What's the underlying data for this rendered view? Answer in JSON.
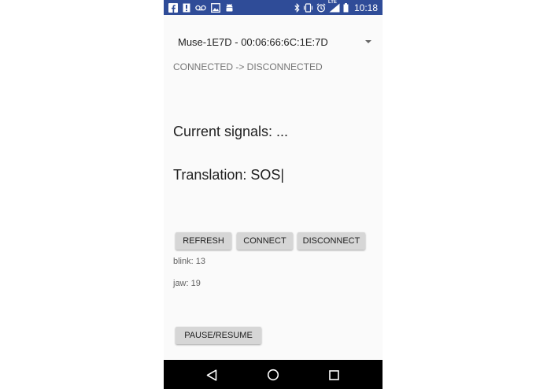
{
  "status_bar": {
    "time": "10:18",
    "network_label": "LTE",
    "background_color": "#2f4c98",
    "left_icons": [
      "facebook-icon",
      "notification-icon",
      "voicemail-icon",
      "image-icon",
      "android-icon"
    ],
    "right_icons": [
      "bluetooth-icon",
      "vibrate-icon",
      "alarm-icon",
      "signal-icon",
      "battery-icon"
    ]
  },
  "device_spinner": {
    "selected": "Muse-1E7D - 00:06:66:6C:1E:7D"
  },
  "connection_status": "CONNECTED -> DISCONNECTED",
  "current_signals": "Current signals: ...",
  "translation": "Translation: SOS|",
  "buttons": {
    "refresh": "REFRESH",
    "connect": "CONNECT",
    "disconnect": "DISCONNECT",
    "pause_resume": "PAUSE/RESUME"
  },
  "stats": {
    "blink": "blink: 13",
    "jaw": "jaw: 19"
  },
  "nav_bar": {
    "buttons": [
      "back-icon",
      "home-icon",
      "recents-icon"
    ]
  }
}
